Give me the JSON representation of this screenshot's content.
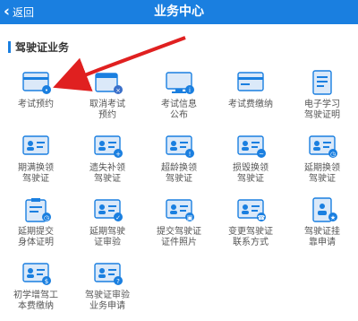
{
  "header": {
    "back_label": "返回",
    "title": "业务中心"
  },
  "section": {
    "title": "驾驶证业务"
  },
  "colors": {
    "header_bg": "#1a7fe0",
    "icon_blue": "#1a7fe0",
    "icon_light": "#dbe9f9",
    "annotation_arrow": "#e02020"
  },
  "items": [
    {
      "label": "考试预约",
      "icon": "card-icon"
    },
    {
      "label": "取消考试\n预约",
      "icon": "calendar-cancel-icon"
    },
    {
      "label": "考试信息\n公布",
      "icon": "monitor-icon"
    },
    {
      "label": "考试费缴纳",
      "icon": "payment-card-icon"
    },
    {
      "label": "电子学习\n驾驶证明",
      "icon": "document-icon"
    },
    {
      "label": "期满换领\n驾驶证",
      "icon": "id-card-icon"
    },
    {
      "label": "遗失补领\n驾驶证",
      "icon": "id-card-plus-icon"
    },
    {
      "label": "超龄换领\n驾驶证",
      "icon": "id-card-person-icon"
    },
    {
      "label": "损毁换领\n驾驶证",
      "icon": "id-card-damaged-icon"
    },
    {
      "label": "延期换领\n驾驶证",
      "icon": "id-card-clock-icon"
    },
    {
      "label": "延期提交\n身体证明",
      "icon": "clipboard-icon"
    },
    {
      "label": "延期驾驶\n证审验",
      "icon": "id-card-check-icon"
    },
    {
      "label": "提交驾驶证\n证件照片",
      "icon": "photo-card-icon"
    },
    {
      "label": "变更驾驶证\n联系方式",
      "icon": "contact-card-icon"
    },
    {
      "label": "驾驶证挂\n靠申请",
      "icon": "document-person-icon"
    },
    {
      "label": "初学增驾工\n本费缴纳",
      "icon": "id-card-pay-icon"
    },
    {
      "label": "驾驶证审验\n业务申请",
      "icon": "id-card-review-icon"
    }
  ]
}
